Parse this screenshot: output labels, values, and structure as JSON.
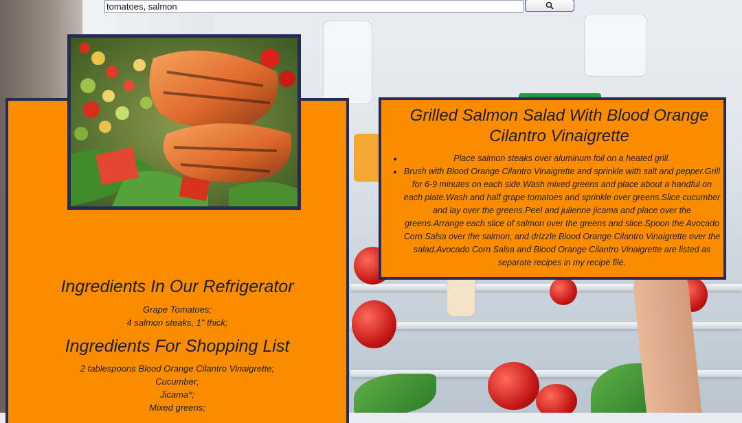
{
  "search": {
    "query": "tomatoes, salmon",
    "button_icon": "search-icon"
  },
  "recipe": {
    "title": "Grilled Salmon Salad With Blood Orange Cilantro Vinaigrette",
    "steps": [
      "Place salmon steaks over aluminum foil on a heated grill.",
      "Brush with Blood Orange Cilantro Vinaigrette and sprinkle with salt and pepper.Grill for 6-9 minutes on each side.Wash mixed greens and place about a handful on each plate.Wash and half grape tomatoes and sprinkle over greens.Slice cucumber and lay over the greens.Peel and julienne jicama and place over the greens.Arrange each slice of salmon over the greens and slice.Spoon the Avocado Corn Salsa over the salmon, and drizzle Blood Orange Cilantro Vinaigrette over the salad.Avocado Corn Salsa and Blood Orange Cilantro Vinaigrette are listed as separate recipes in my recipe file."
    ]
  },
  "fridge": {
    "heading": "Ingredients In Our Refrigerator",
    "items": [
      "Grape Tomatoes;",
      "4 salmon steaks, 1\" thick;"
    ]
  },
  "shopping": {
    "heading": "Ingredients For Shopping List",
    "items": [
      "2 tablespoons Blood Orange Cilantro Vinaigrette;",
      "Cucumber;",
      "Jicama*;",
      "Mixed greens;"
    ]
  },
  "colors": {
    "panel": "#fb8c00",
    "border": "#262b55",
    "text": "#1a1e2e"
  }
}
